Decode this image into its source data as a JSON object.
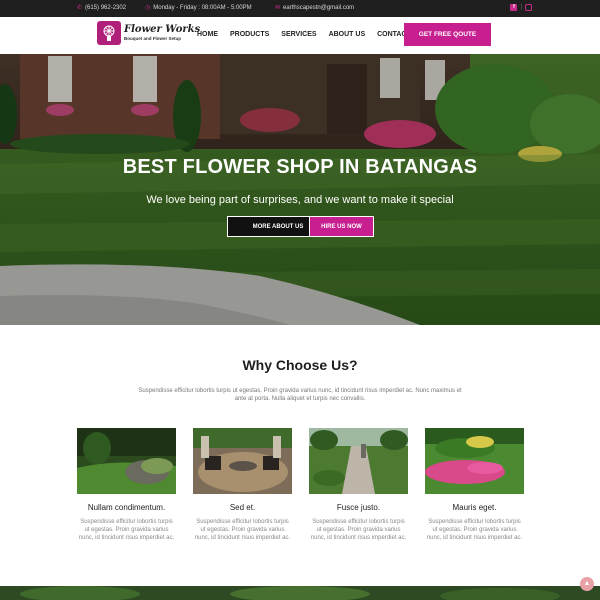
{
  "topbar": {
    "phone": "(615) 962-2302",
    "hours": "Monday - Friday : 08:00AM - 5:00PM",
    "email": "earthscapestn@gmail.com",
    "social_separator": "|"
  },
  "brand": {
    "name": "Flower Works",
    "tagline": "Bouquet and Flower Setup",
    "accent": "#c71f8f"
  },
  "nav": {
    "items": [
      "HOME",
      "PRODUCTS",
      "SERVICES",
      "ABOUT US",
      "CONTACT"
    ],
    "cta": "GET FREE QOUTE"
  },
  "hero": {
    "title": "BEST FLOWER SHOP IN BATANGAS",
    "subtitle": "We love being part of surprises, and we want to make it special",
    "btn_more": "MORE ABOUT US",
    "btn_hire": "HIRE US NOW"
  },
  "why": {
    "title": "Why Choose Us?",
    "description": "Suspendisse efficitur lobortis turpis ut egestas. Proin gravida varius nunc, id tincidunt risus imperdiet ac. Nunc maximus et ante at porta. Nulla aliquet et turpis nec convallis."
  },
  "cards": [
    {
      "title": "Nullam condimentum.",
      "text": "Suspendisse efficitur lobortis turpis ut egestas. Proin gravida varius nunc, id tincidunt risus imperdiet ac."
    },
    {
      "title": "Sed et.",
      "text": "Suspendisse efficitur lobortis turpis ut egestas. Proin gravida varius nunc, id tincidunt risus imperdiet ac."
    },
    {
      "title": "Fusce justo.",
      "text": "Suspendisse efficitur lobortis turpis ut egestas. Proin gravida varius nunc, id tincidunt risus imperdiet ac."
    },
    {
      "title": "Mauris eget.",
      "text": "Suspendisse efficitur lobortis turpis ut egestas. Proin gravida varius nunc, id tincidunt risus imperdiet ac."
    }
  ],
  "icons": {
    "phone": "phone-icon",
    "clock": "clock-icon",
    "email": "email-icon",
    "facebook": "facebook-icon",
    "instagram": "instagram-icon",
    "scroll_top": "arrow-up-icon"
  }
}
